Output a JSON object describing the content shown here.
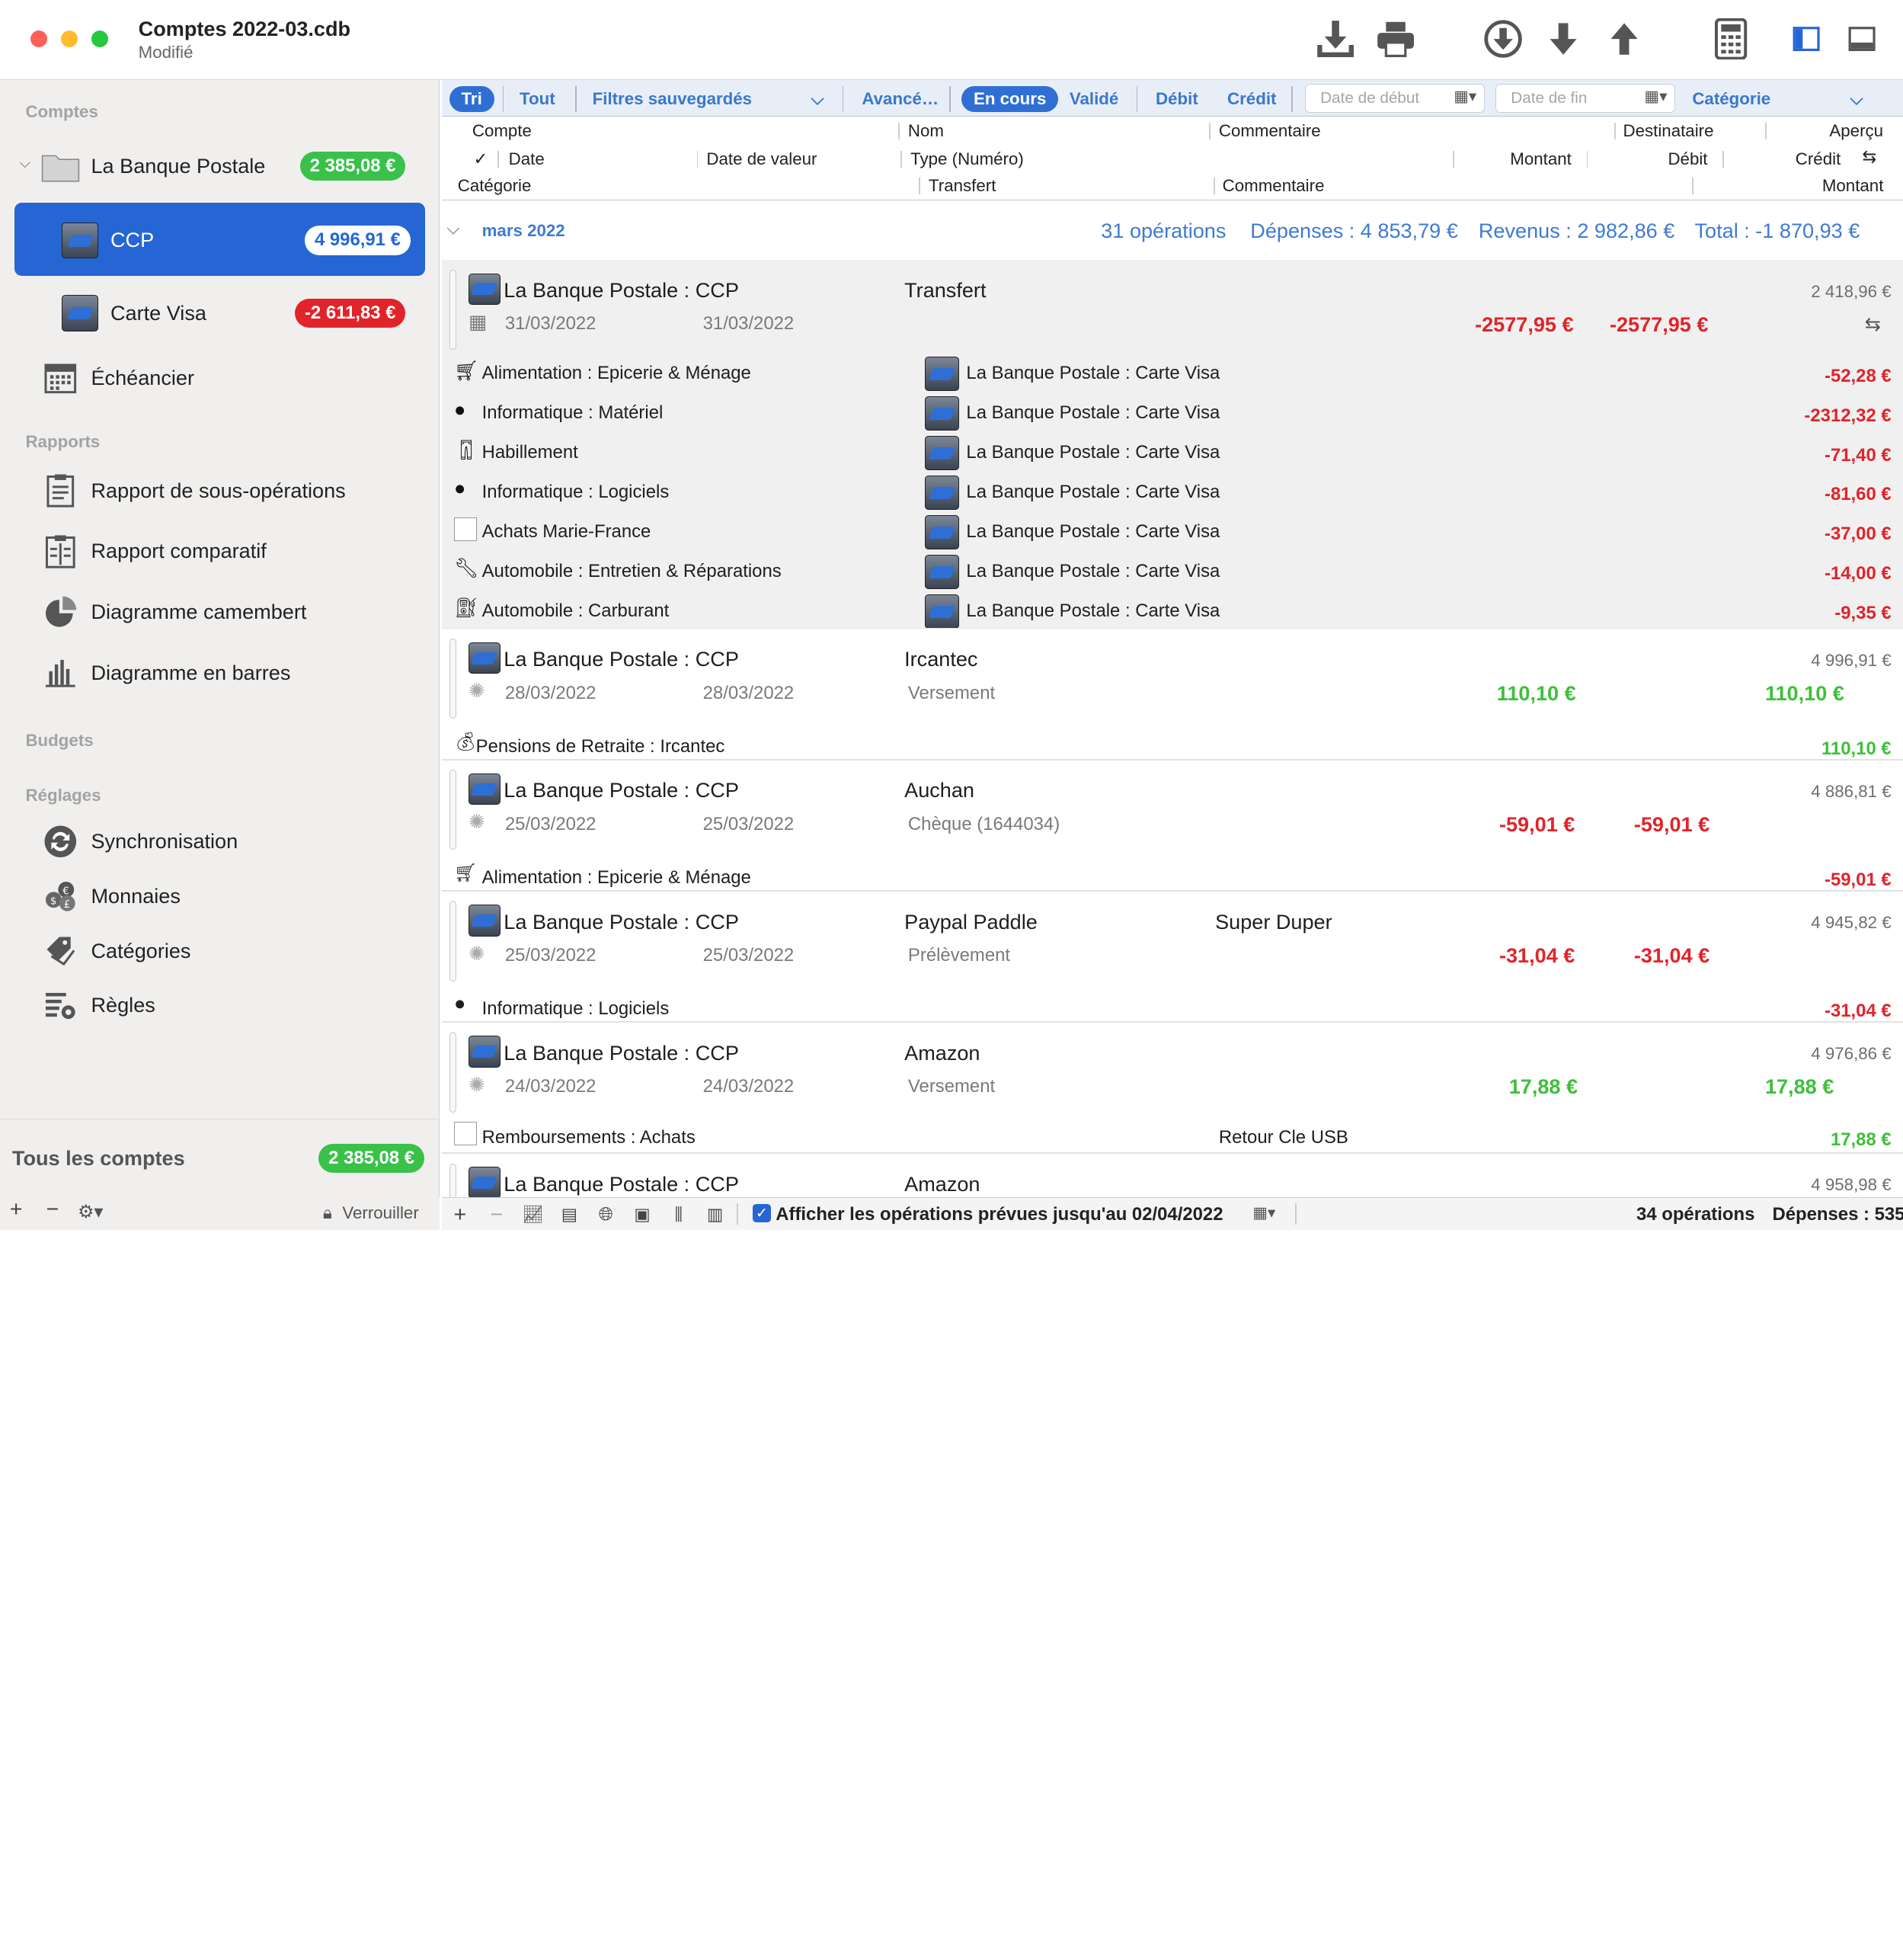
{
  "window": {
    "title": "Comptes 2022-03.cdb",
    "subtitle": "Modifié"
  },
  "colors": {
    "accent": "#2566d4",
    "positive": "#3ec03a",
    "negative": "#e0242a",
    "link": "#3e7bd0"
  },
  "sidebar": {
    "sections": {
      "accounts": "Comptes",
      "reports": "Rapports",
      "budgets": "Budgets",
      "settings": "Réglages"
    },
    "bank": {
      "label": "La Banque Postale",
      "amount": "2 385,08 €"
    },
    "accounts": [
      {
        "label": "CCP",
        "amount": "4 996,91 €",
        "selected": true
      },
      {
        "label": "Carte Visa",
        "amount": "-2 611,83 €"
      }
    ],
    "scheduler": "Échéancier",
    "reports": [
      "Rapport de sous-opérations",
      "Rapport comparatif",
      "Diagramme camembert",
      "Diagramme en barres"
    ],
    "settings": [
      "Synchronisation",
      "Monnaies",
      "Catégories",
      "Règles"
    ],
    "total": {
      "label": "Tous les comptes",
      "amount": "2 385,08 €"
    },
    "lock_label": "Verrouiller"
  },
  "filters": {
    "sort": "Tri",
    "all": "Tout",
    "saved": "Filtres sauvegardés",
    "advanced": "Avancé…",
    "pending": "En cours",
    "validated": "Validé",
    "debit": "Débit",
    "credit": "Crédit",
    "date_start": "Date de début",
    "date_end": "Date de fin",
    "category": "Catégorie"
  },
  "columns": {
    "account": "Compte",
    "name": "Nom",
    "comment": "Commentaire",
    "recipient": "Destinataire",
    "preview": "Aperçu",
    "check": "✓",
    "date": "Date",
    "value_date": "Date de valeur",
    "type": "Type (Numéro)",
    "amount": "Montant",
    "debit": "Débit",
    "credit": "Crédit",
    "category": "Catégorie",
    "transfer": "Transfert",
    "comment2": "Commentaire",
    "amount2": "Montant"
  },
  "month": {
    "label": "mars 2022",
    "count": "31 opérations",
    "expenses": "Dépenses : 4 853,79 €",
    "income": "Revenus : 2 982,86 €",
    "total": "Total : -1 870,93 €"
  },
  "transactions": [
    {
      "account": "La Banque Postale : CCP",
      "name": "Transfert",
      "date": "31/03/2022",
      "value_date": "31/03/2022",
      "type": "",
      "recipient": "",
      "amount": "-2577,95 €",
      "debit": "-2577,95 €",
      "credit": "",
      "balance": "2 418,96 €",
      "splits": [
        {
          "category": "Alimentation : Epicerie & Ménage",
          "icon": "cart-icon",
          "transfer": "La Banque Postale : Carte Visa",
          "amount": "-52,28 €"
        },
        {
          "category": "Informatique : Matériel",
          "icon": "apple-icon",
          "transfer": "La Banque Postale : Carte Visa",
          "amount": "-2312,32 €"
        },
        {
          "category": "Habillement",
          "icon": "clothes-icon",
          "transfer": "La Banque Postale : Carte Visa",
          "amount": "-71,40 €"
        },
        {
          "category": "Informatique : Logiciels",
          "icon": "apple-icon",
          "transfer": "La Banque Postale : Carte Visa",
          "amount": "-81,60 €"
        },
        {
          "category": "Achats Marie-France",
          "icon": "blank-icon",
          "transfer": "La Banque Postale : Carte Visa",
          "amount": "-37,00 €"
        },
        {
          "category": "Automobile : Entretien & Réparations",
          "icon": "car-repair-icon",
          "transfer": "La Banque Postale : Carte Visa",
          "amount": "-14,00 €"
        },
        {
          "category": "Automobile : Carburant",
          "icon": "fuel-icon",
          "transfer": "La Banque Postale : Carte Visa",
          "amount": "-9,35 €"
        }
      ]
    },
    {
      "account": "La Banque Postale : CCP",
      "name": "Ircantec",
      "date": "28/03/2022",
      "value_date": "28/03/2022",
      "type": "Versement",
      "amount": "110,10 €",
      "credit": "110,10 €",
      "balance": "4 996,91 €",
      "split": {
        "category": "Pensions de Retraite : Ircantec",
        "amount": "110,10 €",
        "comment": ""
      }
    },
    {
      "account": "La Banque Postale : CCP",
      "name": "Auchan",
      "date": "25/03/2022",
      "value_date": "25/03/2022",
      "type": "Chèque (1644034)",
      "amount": "-59,01 €",
      "debit": "-59,01 €",
      "balance": "4 886,81 €",
      "split": {
        "category": "Alimentation : Epicerie & Ménage",
        "amount": "-59,01 €",
        "comment": ""
      }
    },
    {
      "account": "La Banque Postale : CCP",
      "name": "Paypal Paddle",
      "recipient": "Super Duper",
      "date": "25/03/2022",
      "value_date": "25/03/2022",
      "type": "Prélèvement",
      "amount": "-31,04 €",
      "debit": "-31,04 €",
      "balance": "4 945,82 €",
      "split": {
        "category": "Informatique : Logiciels",
        "amount": "-31,04 €",
        "comment": ""
      }
    },
    {
      "account": "La Banque Postale : CCP",
      "name": "Amazon",
      "date": "24/03/2022",
      "value_date": "24/03/2022",
      "type": "Versement",
      "amount": "17,88 €",
      "credit": "17,88 €",
      "balance": "4 976,86 €",
      "split": {
        "category": "Remboursements : Achats",
        "amount": "17,88 €",
        "comment": "Retour Cle USB"
      }
    },
    {
      "account": "La Banque Postale : CCP",
      "name": "Amazon",
      "balance": "4 958,98 €"
    }
  ],
  "footer": {
    "show_planned": "Afficher les opérations prévues jusqu'au 02/04/2022",
    "ops_count": "34 opérations",
    "expenses": "Dépenses : 535"
  }
}
